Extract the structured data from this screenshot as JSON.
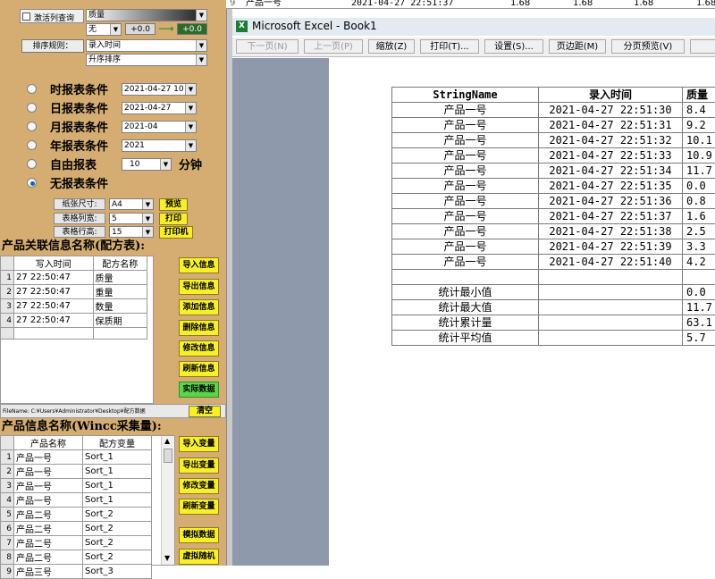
{
  "top_sheet": {
    "row_num": "9",
    "product": "产品一号",
    "time": "2021-04-27 22:51:37",
    "v1": "1.68",
    "v2": "1.68",
    "v3": "1.68",
    "v4": "1.68"
  },
  "query": {
    "activate_label": "激活列查询",
    "field": "质量",
    "cond": "无",
    "min": "+0.0",
    "max": "+0.0",
    "sort_label": "排序规则：",
    "sort_field": "录入时间",
    "sort_order": "升序排序"
  },
  "report_options": [
    {
      "label": "时报表条件",
      "value": "2021-04-27 10"
    },
    {
      "label": "日报表条件",
      "value": "2021-04-27"
    },
    {
      "label": "月报表条件",
      "value": "2021-04"
    },
    {
      "label": "年报表条件",
      "value": "2021"
    },
    {
      "label": "自由报表",
      "value": "10",
      "unit": "分钟"
    },
    {
      "label": "无报表条件",
      "value": ""
    }
  ],
  "print_opts": {
    "paper_label": "纸张尺寸:",
    "paper": "A4",
    "cols_label": "表格列宽:",
    "cols": "5",
    "rows_label": "表格行高:",
    "rows": "15",
    "preview": "预览",
    "print": "打印",
    "printer": "打印机"
  },
  "formula": {
    "title": "产品关联信息名称(配方表):",
    "headers": [
      "写入时间",
      "配方名称"
    ],
    "rows": [
      [
        "1",
        "27 22:50:47",
        "质量"
      ],
      [
        "2",
        "27 22:50:47",
        "重量"
      ],
      [
        "3",
        "27 22:50:47",
        "数量"
      ],
      [
        "4",
        "27 22:50:47",
        "保质期"
      ]
    ],
    "buttons": [
      "导入信息",
      "导出信息",
      "添加信息",
      "删除信息",
      "修改信息",
      "刷新信息"
    ],
    "green_button": "实际数据库",
    "filename": "FileName: C:¥Users¥Administrator¥Desktop¥配方数据",
    "clear": "清空"
  },
  "wincc": {
    "title": "产品信息名称(Wincc采集量):",
    "headers": [
      "产品名称",
      "配方变量"
    ],
    "rows": [
      [
        "1",
        "产品一号",
        "Sort_1"
      ],
      [
        "2",
        "产品一号",
        "Sort_1"
      ],
      [
        "3",
        "产品一号",
        "Sort_1"
      ],
      [
        "4",
        "产品一号",
        "Sort_1"
      ],
      [
        "5",
        "产品二号",
        "Sort_2"
      ],
      [
        "6",
        "产品二号",
        "Sort_2"
      ],
      [
        "7",
        "产品二号",
        "Sort_2"
      ],
      [
        "8",
        "产品二号",
        "Sort_2"
      ],
      [
        "9",
        "产品三号",
        "Sort_3"
      ]
    ],
    "buttons": [
      "导入变量",
      "导出变量",
      "修改变量",
      "刷新变量"
    ],
    "bottom_buttons": [
      "模拟数据库",
      "虚拟随机值"
    ]
  },
  "excel": {
    "title": "Microsoft Excel - Book1",
    "toolbar": [
      "下一页(N)",
      "上一页(P)",
      "缩放(Z)",
      "打印(T)...",
      "设置(S)...",
      "页边距(M)",
      "分页预览(V)"
    ],
    "headers": [
      "StringName",
      "录入时间",
      "质量"
    ],
    "rows": [
      [
        "产品一号",
        "2021-04-27 22:51:30",
        "8.4"
      ],
      [
        "产品一号",
        "2021-04-27 22:51:31",
        "9.2"
      ],
      [
        "产品一号",
        "2021-04-27 22:51:32",
        "10.1"
      ],
      [
        "产品一号",
        "2021-04-27 22:51:33",
        "10.9"
      ],
      [
        "产品一号",
        "2021-04-27 22:51:34",
        "11.7"
      ],
      [
        "产品一号",
        "2021-04-27 22:51:35",
        "0.0"
      ],
      [
        "产品一号",
        "2021-04-27 22:51:36",
        "0.8"
      ],
      [
        "产品一号",
        "2021-04-27 22:51:37",
        "1.6"
      ],
      [
        "产品一号",
        "2021-04-27 22:51:38",
        "2.5"
      ],
      [
        "产品一号",
        "2021-04-27 22:51:39",
        "3.3"
      ],
      [
        "产品一号",
        "2021-04-27 22:51:40",
        "4.2"
      ]
    ],
    "stats": [
      [
        "统计最小值",
        "0.0"
      ],
      [
        "统计最大值",
        "11.7"
      ],
      [
        "统计累计量",
        "63.1"
      ],
      [
        "统计平均值",
        "5.7"
      ]
    ]
  }
}
